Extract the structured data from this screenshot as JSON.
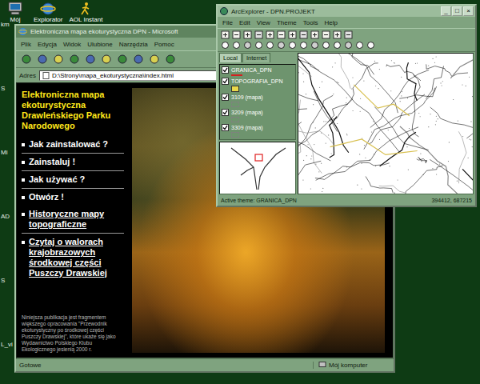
{
  "desktop": {
    "icons": [
      {
        "label": "Mój",
        "kind": "computer"
      },
      {
        "label": "Explorator",
        "kind": "browser"
      },
      {
        "label": "AOL Instant",
        "kind": "messenger"
      }
    ],
    "edge_labels": [
      "km",
      "S",
      "Mi",
      "AD",
      "S",
      "L_vi"
    ]
  },
  "browser": {
    "title": "Elektroniczna mapa ekoturystyczna DPN - Microsoft",
    "menu": [
      "Plik",
      "Edycja",
      "Widok",
      "Ulubione",
      "Narzędzia",
      "Pomoc"
    ],
    "address_label": "Adres",
    "address": "D:\\Strony\\mapa_ekoturystyczna\\index.html",
    "page": {
      "title": "Elektroniczna mapa ekoturystyczna Drawleńskiego Parku Narodowego",
      "links": [
        {
          "label": "Jak zainstalować ?",
          "underlined": false,
          "separator": true
        },
        {
          "label": "Zainstaluj !",
          "underlined": false,
          "separator": true
        },
        {
          "label": "Jak używać ?",
          "underlined": false,
          "separator": true
        },
        {
          "label": "Otwórz !",
          "underlined": false,
          "separator": false
        },
        {
          "label": "Historyczne mapy topograficzne",
          "underlined": true,
          "separator": true
        },
        {
          "label": "Czytaj o walorach krajobrazowych środkowej części Puszczy Drawskiej",
          "underlined": true,
          "separator": false
        }
      ],
      "note": "Niniejsza publikacja jest fragmentem większego opracowania \"Przewodnik ekoturystyczny po środkowej części Puszczy Drawskiej\", które ukaże się jako Wydawnictwo Polskiego Klubu Ekologicznego jesienią 2000 r."
    },
    "status": "Gotowe",
    "zone": "Mój komputer"
  },
  "gis": {
    "title": "ArcExplorer - DPN.PROJEKT",
    "controls": [
      "_",
      "□",
      "×"
    ],
    "menu": [
      "File",
      "Edit",
      "View",
      "Theme",
      "Tools",
      "Help"
    ],
    "tabs": [
      {
        "label": "Local",
        "selected": true
      },
      {
        "label": "Internet",
        "selected": false
      }
    ],
    "themes": [
      {
        "label": "GRANICA_DPN",
        "checked": true,
        "kind": "line",
        "color": "#d42020"
      },
      {
        "label": "TOPOGRAFIA_DPN",
        "checked": true,
        "kind": "fill",
        "color": "#e8d84a"
      },
      {
        "label": "3109 (mapa)",
        "checked": true,
        "kind": "image",
        "color": "#808080"
      },
      {
        "label": "3209 (mapa)",
        "checked": true,
        "kind": "image",
        "color": "#808080"
      },
      {
        "label": "3309 (mapa)",
        "checked": true,
        "kind": "image",
        "color": "#808080"
      }
    ],
    "status": "Active theme: GRANICA_DPN",
    "coords": "394412, 687215"
  }
}
